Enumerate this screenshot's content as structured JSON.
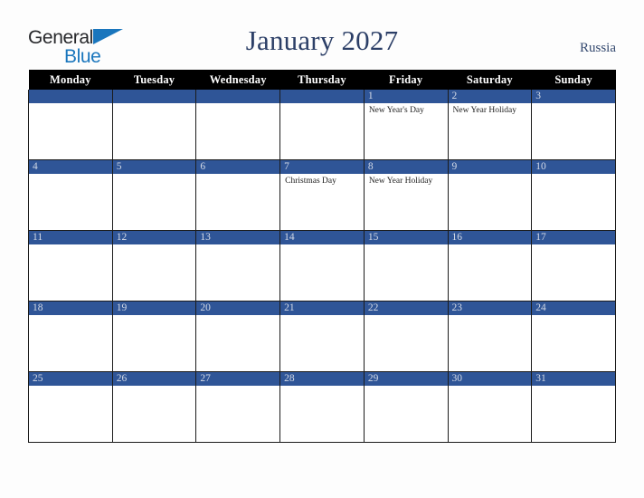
{
  "logo": {
    "word1": "General",
    "word2": "Blue",
    "triangle_color": "#1a76bd",
    "word1_color": "#27282b",
    "word2_color": "#1a76bd"
  },
  "header": {
    "title": "January 2027",
    "country": "Russia",
    "title_color": "#2c3f67",
    "country_color": "#34496f"
  },
  "calendar": {
    "accent_color": "#2f5597",
    "header_bg": "#000000",
    "header_fg": "#ffffff",
    "weekday_headers": [
      "Monday",
      "Tuesday",
      "Wednesday",
      "Thursday",
      "Friday",
      "Saturday",
      "Sunday"
    ],
    "weeks": [
      [
        {
          "day": "",
          "events": []
        },
        {
          "day": "",
          "events": []
        },
        {
          "day": "",
          "events": []
        },
        {
          "day": "",
          "events": []
        },
        {
          "day": "1",
          "events": [
            "New Year's Day"
          ]
        },
        {
          "day": "2",
          "events": [
            "New Year Holiday"
          ]
        },
        {
          "day": "3",
          "events": []
        }
      ],
      [
        {
          "day": "4",
          "events": []
        },
        {
          "day": "5",
          "events": []
        },
        {
          "day": "6",
          "events": []
        },
        {
          "day": "7",
          "events": [
            "Christmas Day"
          ]
        },
        {
          "day": "8",
          "events": [
            "New Year Holiday"
          ]
        },
        {
          "day": "9",
          "events": []
        },
        {
          "day": "10",
          "events": []
        }
      ],
      [
        {
          "day": "11",
          "events": []
        },
        {
          "day": "12",
          "events": []
        },
        {
          "day": "13",
          "events": []
        },
        {
          "day": "14",
          "events": []
        },
        {
          "day": "15",
          "events": []
        },
        {
          "day": "16",
          "events": []
        },
        {
          "day": "17",
          "events": []
        }
      ],
      [
        {
          "day": "18",
          "events": []
        },
        {
          "day": "19",
          "events": []
        },
        {
          "day": "20",
          "events": []
        },
        {
          "day": "21",
          "events": []
        },
        {
          "day": "22",
          "events": []
        },
        {
          "day": "23",
          "events": []
        },
        {
          "day": "24",
          "events": []
        }
      ],
      [
        {
          "day": "25",
          "events": []
        },
        {
          "day": "26",
          "events": []
        },
        {
          "day": "27",
          "events": []
        },
        {
          "day": "28",
          "events": []
        },
        {
          "day": "29",
          "events": []
        },
        {
          "day": "30",
          "events": []
        },
        {
          "day": "31",
          "events": []
        }
      ]
    ]
  }
}
